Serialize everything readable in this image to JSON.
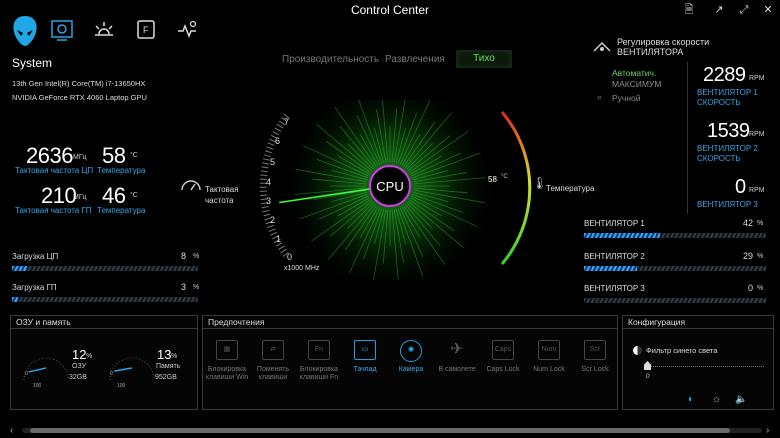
{
  "window": {
    "title": "Control Center"
  },
  "nav": {
    "icons": [
      "alien-head-icon",
      "system-settings-icon",
      "lighting-icon",
      "f-key-icon",
      "macro-icon"
    ]
  },
  "system": {
    "heading": "System",
    "cpu_name": "13th Gen Intel(R) Core(TM) i7-13650HX",
    "gpu_name": "NVIDIA GeForce RTX 4060 Laptop GPU",
    "cpu_clock": {
      "value": "2636",
      "unit": "МГц",
      "label": "Тактовая частота ЦП"
    },
    "cpu_temp": {
      "value": "58",
      "unit": "°C",
      "label": "Температура"
    },
    "gpu_clock": {
      "value": "210",
      "unit": "МГц",
      "label": "Тактовая частота ГП"
    },
    "gpu_temp": {
      "value": "46",
      "unit": "°C",
      "label": "Температура"
    },
    "cpu_load": {
      "label": "Загрузка ЦП",
      "value": "8",
      "unit": "%",
      "fraction": 0.08
    },
    "gpu_load": {
      "label": "Загрузка ГП",
      "value": "3",
      "unit": "%",
      "fraction": 0.03
    }
  },
  "modes": {
    "items": [
      "Производительность",
      "Развлечения",
      "Тихо"
    ],
    "active": "Тихо"
  },
  "gauge": {
    "center_label": "CPU",
    "clock_label_line1": "Тактовая",
    "clock_label_line2": "частота",
    "ticks": [
      "0",
      "1",
      "2",
      "3",
      "4",
      "5",
      "6",
      "7"
    ],
    "scale_unit": "x1000 MHz",
    "clock_ghz": 2.636,
    "temp_value": "58",
    "temp_unit": "°C",
    "temp_label": "Температура",
    "temp_fraction": 0.58
  },
  "fans": {
    "title_line1": "Регулировка скорости",
    "title_line2": "ВЕНТИЛЯТОРА",
    "mode_auto": "Автоматич.",
    "mode_max": "МАКСИМУМ",
    "mode_manual": "Ручной",
    "fan1": {
      "value": "2289",
      "unit": "RPM",
      "label1": "ВЕНТИЛЯТОР 1",
      "label2": "СКОРОСТЬ"
    },
    "fan2": {
      "value": "1539",
      "unit": "RPM",
      "label1": "ВЕНТИЛЯТОР 2",
      "label2": "СКОРОСТЬ"
    },
    "fan3": {
      "value": "0",
      "unit": "RPM",
      "label1": "ВЕНТИЛЯТОР 3"
    },
    "bars": [
      {
        "label": "ВЕНТИЛЯТОР 1",
        "value": "42",
        "unit": "%",
        "fraction": 0.42
      },
      {
        "label": "ВЕНТИЛЯТОР 2",
        "value": "29",
        "unit": "%",
        "fraction": 0.29
      },
      {
        "label": "ВЕНТИЛЯТОР 3",
        "value": "0",
        "unit": "%",
        "fraction": 0
      }
    ]
  },
  "memory": {
    "title": "ОЗУ и память",
    "ram": {
      "value": "12",
      "unit": "%",
      "label": "ОЗУ",
      "size": "32GB",
      "fraction": 0.12
    },
    "storage": {
      "value": "13",
      "unit": "%",
      "label": "Память",
      "size": "952GB",
      "fraction": 0.13
    },
    "dial_min": "0",
    "dial_max": "100"
  },
  "preferences": {
    "title": "Предпочтения",
    "items": [
      {
        "line1": "Блокировка",
        "line2": "клавиши Win",
        "icon": "windows-key-icon",
        "active": false
      },
      {
        "line1": "Поменять",
        "line2": "клавиши",
        "icon": "swap-keys-icon",
        "active": false
      },
      {
        "line1": "Блокировка",
        "line2": "клавиши Fn",
        "icon": "fn-key-icon",
        "active": false
      },
      {
        "line1": "Тачпад",
        "line2": "",
        "icon": "touchpad-icon",
        "active": true
      },
      {
        "line1": "Камера",
        "line2": "",
        "icon": "camera-icon",
        "active": true
      },
      {
        "line1": "В самолете",
        "line2": "",
        "icon": "airplane-icon",
        "active": false
      },
      {
        "line1": "Caps Lock",
        "line2": "",
        "icon": "caps-lock-icon",
        "active": false
      },
      {
        "line1": "Num Lock",
        "line2": "",
        "icon": "num-lock-icon",
        "active": false
      },
      {
        "line1": "Scr Lock",
        "line2": "",
        "icon": "scroll-lock-icon",
        "active": false
      }
    ],
    "icon_text": [
      "",
      "",
      "Fn",
      "",
      "",
      "",
      "Caps",
      "Num",
      "Scr"
    ]
  },
  "config": {
    "title": "Конфигурация",
    "blue_filter_label": "Фильтр синего света",
    "blue_filter_value": "0"
  }
}
